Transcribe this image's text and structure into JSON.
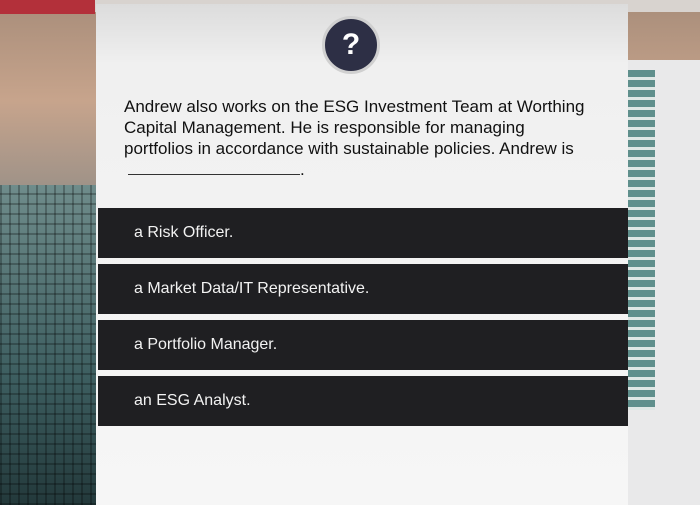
{
  "question": {
    "icon": "question-mark-icon",
    "icon_glyph": "?",
    "text": "Andrew also works on the ESG Investment Team at Worthing Capital Management. He is responsible for managing portfolios in accordance with sustainable policies. Andrew is",
    "end_punct": "."
  },
  "options": [
    {
      "label": "a Risk Officer."
    },
    {
      "label": "a Market Data/IT Representative."
    },
    {
      "label": "a Portfolio Manager."
    },
    {
      "label": "an ESG Analyst."
    }
  ]
}
